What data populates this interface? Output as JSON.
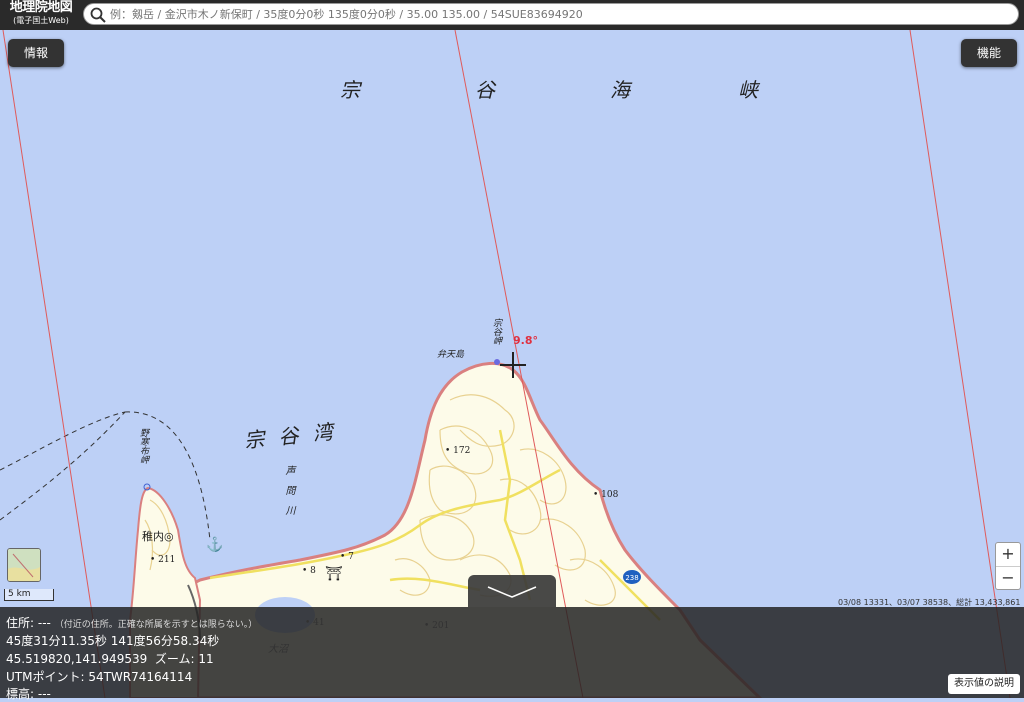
{
  "header": {
    "logo_line1": "地理院地図",
    "logo_line2": "(電子国土Web)",
    "search_placeholder": "例：剱岳 / 金沢市木ノ新保町 / 35度0分0秒 135度0分0秒 / 35.00 135.00 / 54SUE83694920"
  },
  "buttons": {
    "info": "情報",
    "function": "機能",
    "explain": "表示値の説明"
  },
  "map_labels": {
    "strait": [
      "宗",
      "谷",
      "海",
      "峡"
    ],
    "bay": "宗 谷 湾",
    "cape": "宗谷岬",
    "benten": "弁天島",
    "noshappu": "野寒布岬",
    "koetoi": "声問川",
    "wakkanai": "稚内◎",
    "elev_211": "211",
    "elev_172": "172",
    "elev_108": "108",
    "elev_8": "8",
    "elev_7": "7",
    "elev_41": "41",
    "elev_201": "201",
    "route": "238",
    "onuma": "大沼"
  },
  "declination": "9.8°",
  "zoom_in": "+",
  "zoom_out": "−",
  "scale": "5 km",
  "attribution": "03/08 13331、03/07 38538、総計 13,433,861",
  "info": {
    "address_label": "住所: ---",
    "address_note": "（付近の住所。正確な所属を示すとは限らない。）",
    "dms": "45度31分11.35秒 141度56分58.34秒",
    "decimal": "45.519820,141.949539",
    "zoom": "ズーム: 11",
    "utm": "UTMポイント:  54TWR74164114",
    "elevation": "標高:  ---"
  },
  "colors": {
    "sea": "#bdd0f6",
    "land": "#fdfbe9",
    "coast": "#d98080",
    "contour": "#e8d190",
    "road": "#f0e060",
    "grid": "#e05a5a",
    "declination": "#e03040"
  }
}
